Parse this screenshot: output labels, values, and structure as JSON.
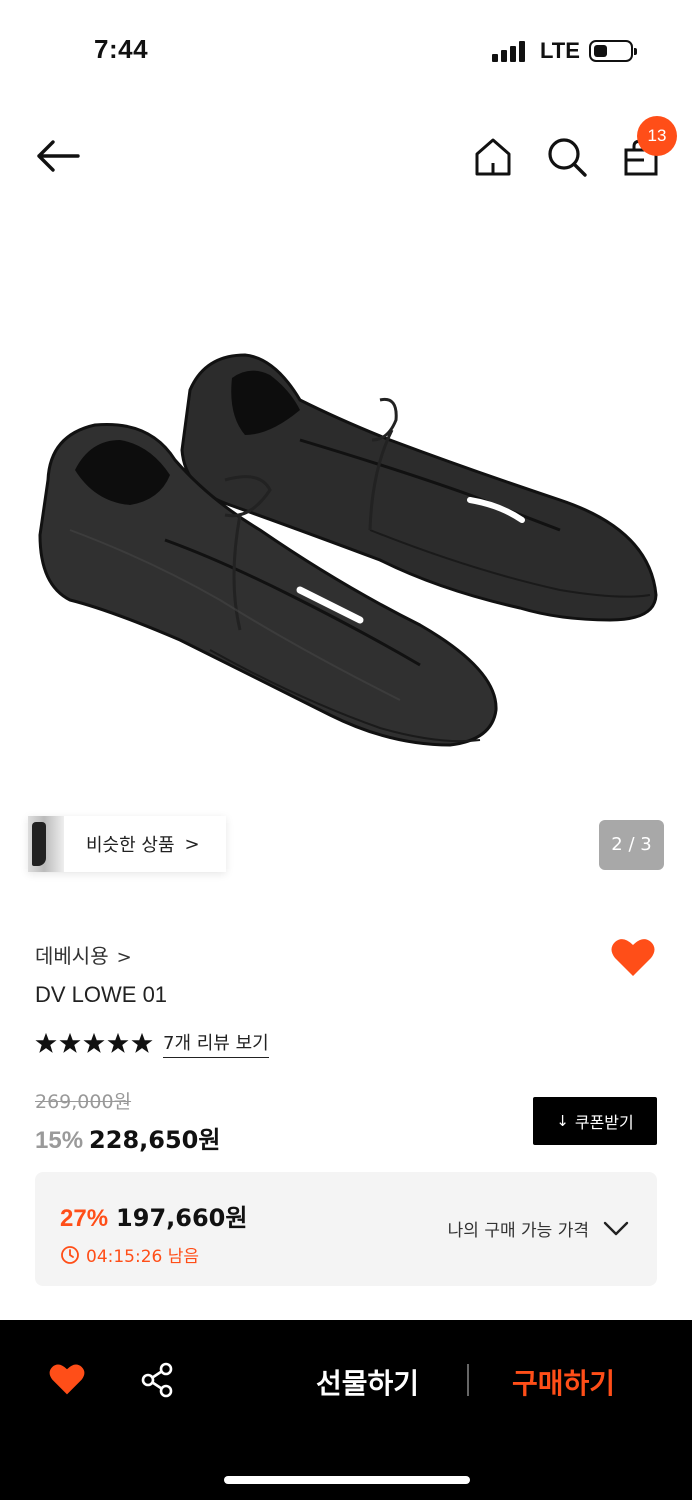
{
  "status_bar": {
    "time": "7:44",
    "network": "LTE"
  },
  "nav": {
    "back_icon": "arrow-left-icon",
    "home_icon": "home-icon",
    "search_icon": "search-icon",
    "cart_icon": "shopping-bag-icon",
    "cart_count": "13"
  },
  "gallery": {
    "similar_label": "비슷한 상품",
    "similar_chevron": ">",
    "page_indicator": "2 / 3"
  },
  "product": {
    "brand": "데베시용",
    "brand_chevron": ">",
    "name": "DV LOWE 01",
    "rating_stars": 5,
    "review_link": "7개 리뷰 보기",
    "original_price": "269,000원",
    "discount_percent": "15%",
    "sale_price": "228,650원",
    "coupon_label": "쿠폰받기",
    "coupon_icon": "↓",
    "liked": true
  },
  "best_price": {
    "percent": "27%",
    "price": "197,660원",
    "timer": "04:15:26 남음",
    "my_price_label": "나의 구매 가능 가격"
  },
  "bottom_bar": {
    "gift_label": "선물하기",
    "buy_label": "구매하기"
  },
  "colors": {
    "accent": "#ff4e18",
    "dark": "#000000",
    "muted": "#9a9a9a"
  }
}
